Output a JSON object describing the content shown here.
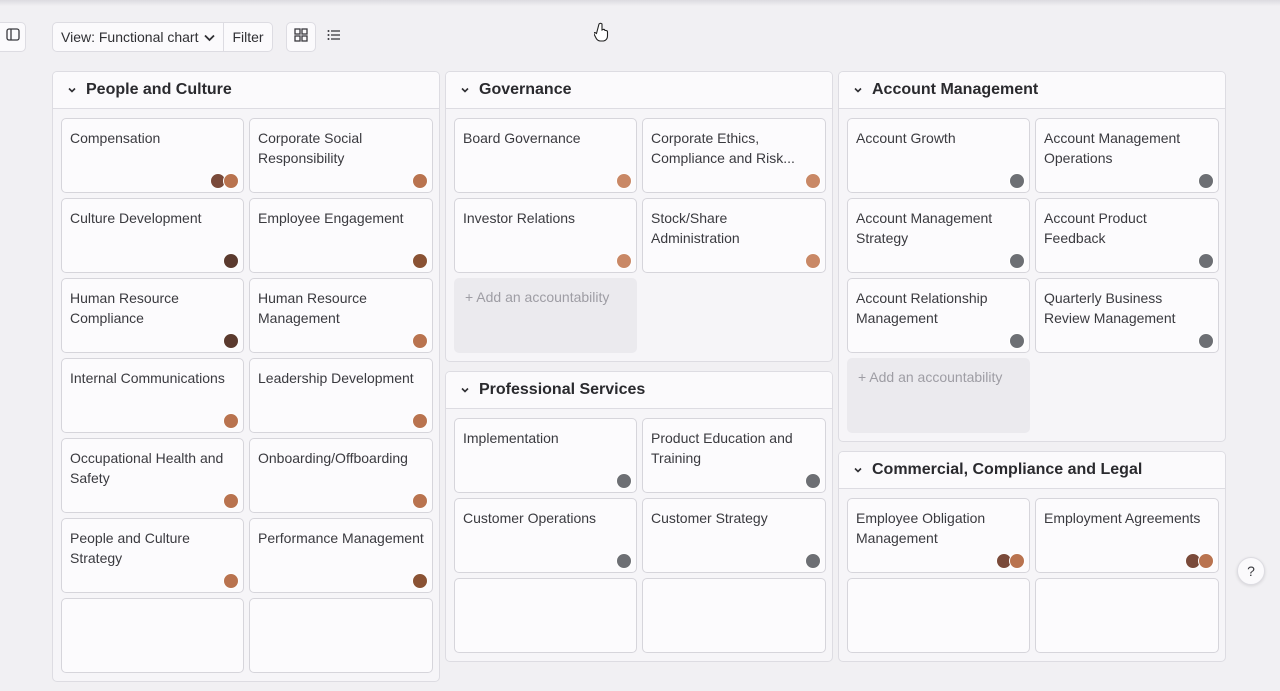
{
  "toolbar": {
    "view_label": "View: Functional chart",
    "filter_label": "Filter",
    "view_modes": [
      {
        "name": "grid-view-icon",
        "active": true
      },
      {
        "name": "list-view-icon",
        "active": false
      }
    ]
  },
  "add_label": "+ Add an accountability",
  "help_label": "?",
  "avatar_colors": {
    "a": "#7a4a3a",
    "b": "#c98866",
    "c": "#6d6f74",
    "d": "#8a5234",
    "e": "#b9734f",
    "f": "#5b3a2e"
  },
  "columns": [
    {
      "panels": [
        {
          "title": "People and Culture",
          "show_add": false,
          "cards": [
            {
              "label": "Compensation",
              "avatars": [
                "a",
                "e"
              ]
            },
            {
              "label": "Corporate Social Responsibility",
              "avatars": [
                "e"
              ]
            },
            {
              "label": "Culture Development",
              "avatars": [
                "f"
              ]
            },
            {
              "label": "Employee Engagement",
              "avatars": [
                "d"
              ]
            },
            {
              "label": "Human Resource Compliance",
              "avatars": [
                "f"
              ]
            },
            {
              "label": "Human Resource Management",
              "avatars": [
                "e"
              ]
            },
            {
              "label": "Internal Communications",
              "avatars": [
                "e"
              ]
            },
            {
              "label": "Leadership Development",
              "avatars": [
                "e"
              ]
            },
            {
              "label": "Occupational Health and Safety",
              "avatars": [
                "e"
              ]
            },
            {
              "label": "Onboarding/Offboarding",
              "avatars": [
                "e"
              ]
            },
            {
              "label": "People and Culture Strategy",
              "avatars": [
                "e"
              ]
            },
            {
              "label": "Performance Management",
              "avatars": [
                "d"
              ]
            },
            {
              "label": "",
              "avatars": []
            },
            {
              "label": "",
              "avatars": []
            }
          ]
        }
      ]
    },
    {
      "panels": [
        {
          "title": "Governance",
          "show_add": true,
          "cards": [
            {
              "label": "Board Governance",
              "avatars": [
                "b"
              ]
            },
            {
              "label": "Corporate Ethics, Compliance and Risk...",
              "avatars": [
                "b"
              ]
            },
            {
              "label": "Investor Relations",
              "avatars": [
                "b"
              ]
            },
            {
              "label": "Stock/Share Administration",
              "avatars": [
                "b"
              ]
            }
          ]
        },
        {
          "title": "Professional Services",
          "show_add": false,
          "cards": [
            {
              "label": "Implementation",
              "avatars": [
                "c"
              ]
            },
            {
              "label": "Product Education and Training",
              "avatars": [
                "c"
              ]
            },
            {
              "label": "Customer Operations",
              "avatars": [
                "c"
              ]
            },
            {
              "label": "Customer Strategy",
              "avatars": [
                "c"
              ]
            },
            {
              "label": "",
              "avatars": []
            },
            {
              "label": "",
              "avatars": []
            }
          ]
        }
      ]
    },
    {
      "panels": [
        {
          "title": "Account Management",
          "show_add": true,
          "cards": [
            {
              "label": "Account Growth",
              "avatars": [
                "c"
              ]
            },
            {
              "label": "Account Management Operations",
              "avatars": [
                "c"
              ]
            },
            {
              "label": "Account Management Strategy",
              "avatars": [
                "c"
              ]
            },
            {
              "label": "Account Product Feedback",
              "avatars": [
                "c"
              ]
            },
            {
              "label": "Account Relationship Management",
              "avatars": [
                "c"
              ]
            },
            {
              "label": "Quarterly Business Review Management",
              "avatars": [
                "c"
              ]
            }
          ]
        },
        {
          "title": "Commercial, Compliance and Legal",
          "show_add": false,
          "cards": [
            {
              "label": "Employee Obligation Management",
              "avatars": [
                "a",
                "e"
              ]
            },
            {
              "label": "Employment Agreements",
              "avatars": [
                "a",
                "e"
              ]
            },
            {
              "label": "",
              "avatars": []
            },
            {
              "label": "",
              "avatars": []
            }
          ]
        }
      ]
    }
  ]
}
